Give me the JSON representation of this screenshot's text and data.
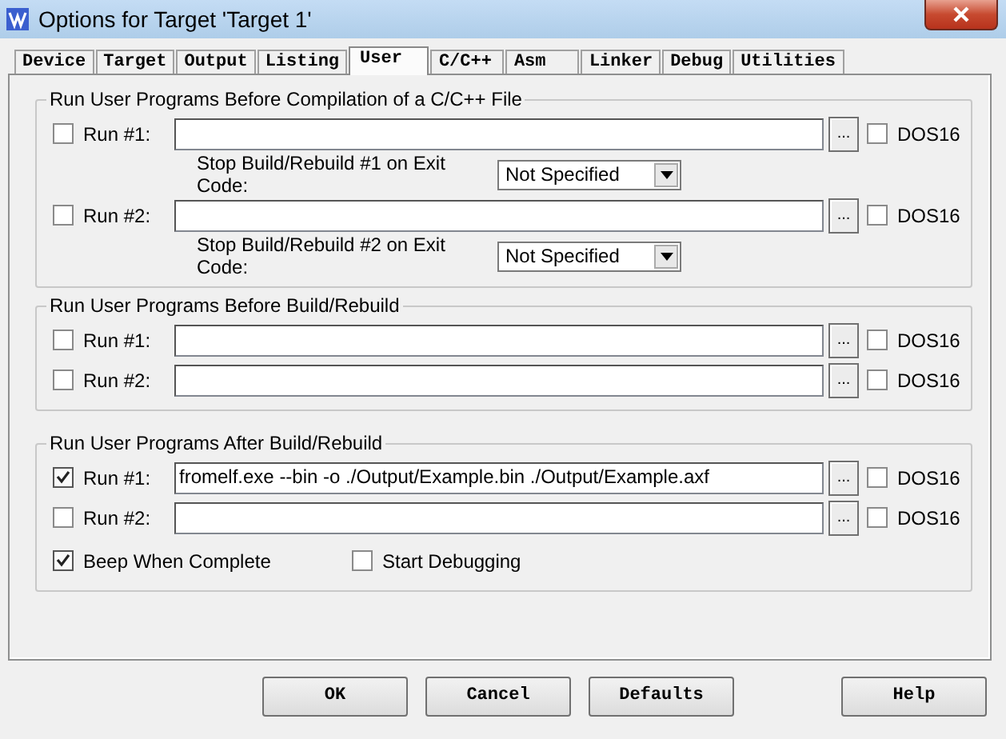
{
  "window": {
    "title": "Options for Target 'Target 1'"
  },
  "tabs": [
    {
      "label": "Device",
      "selected": false
    },
    {
      "label": "Target",
      "selected": false
    },
    {
      "label": "Output",
      "selected": false
    },
    {
      "label": "Listing",
      "selected": false
    },
    {
      "label": "User",
      "selected": true
    },
    {
      "label": "C/C++",
      "selected": false
    },
    {
      "label": "Asm",
      "selected": false
    },
    {
      "label": "Linker",
      "selected": false
    },
    {
      "label": "Debug",
      "selected": false
    },
    {
      "label": "Utilities",
      "selected": false
    }
  ],
  "groups": [
    {
      "title": "Run User Programs Before Compilation of a C/C++ File",
      "rows": [
        {
          "kind": "run",
          "label": "Run #1:",
          "checked": false,
          "value": "",
          "browse": "...",
          "dos_label": "DOS16",
          "dos16": false
        },
        {
          "kind": "exit",
          "label": "Stop Build/Rebuild #1 on Exit Code:",
          "value": "Not Specified"
        },
        {
          "kind": "run",
          "label": "Run #2:",
          "checked": false,
          "value": "",
          "browse": "...",
          "dos_label": "DOS16",
          "dos16": false
        },
        {
          "kind": "exit",
          "label": "Stop Build/Rebuild #2 on Exit Code:",
          "value": "Not Specified"
        }
      ]
    },
    {
      "title": "Run User Programs Before Build/Rebuild",
      "rows": [
        {
          "kind": "run",
          "label": "Run #1:",
          "checked": false,
          "value": "",
          "browse": "...",
          "dos_label": "DOS16",
          "dos16": false
        },
        {
          "kind": "run",
          "label": "Run #2:",
          "checked": false,
          "value": "",
          "browse": "...",
          "dos_label": "DOS16",
          "dos16": false
        }
      ]
    },
    {
      "title": "Run User Programs After Build/Rebuild",
      "rows": [
        {
          "kind": "run",
          "label": "Run #1:",
          "checked": true,
          "value": "fromelf.exe --bin -o ./Output/Example.bin ./Output/Example.axf",
          "browse": "...",
          "dos_label": "DOS16",
          "dos16": false
        },
        {
          "kind": "run",
          "label": "Run #2:",
          "checked": false,
          "value": "",
          "browse": "...",
          "dos_label": "DOS16",
          "dos16": false
        },
        {
          "kind": "options",
          "items": [
            {
              "label": "Beep When Complete",
              "checked": true
            },
            {
              "label": "Start Debugging",
              "checked": false
            }
          ]
        }
      ]
    }
  ],
  "buttons": [
    {
      "label": "OK"
    },
    {
      "label": "Cancel"
    },
    {
      "label": "Defaults"
    },
    {
      "label": "Help"
    }
  ]
}
